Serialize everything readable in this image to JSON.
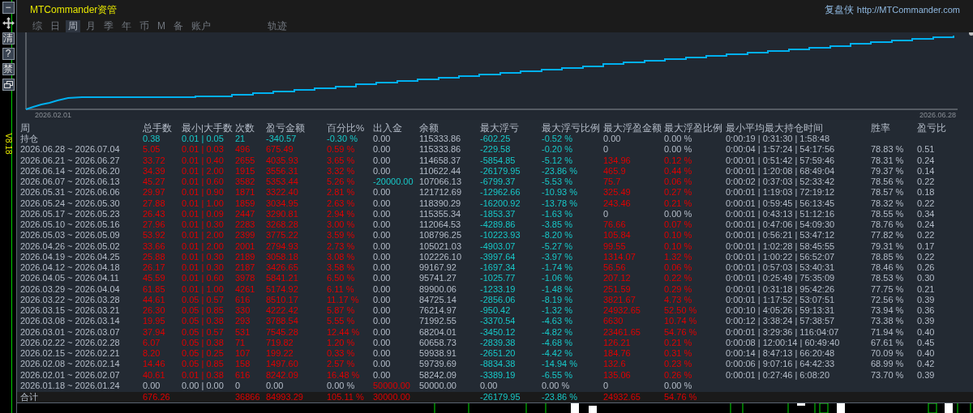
{
  "sidebar": {
    "buttons": [
      {
        "kind": "text",
        "label": "−"
      },
      {
        "kind": "move"
      },
      {
        "kind": "text",
        "label": "清"
      },
      {
        "kind": "text",
        "label": "?"
      },
      {
        "kind": "text",
        "label": "禁"
      },
      {
        "kind": "restore"
      }
    ],
    "version": "V8.18"
  },
  "header": {
    "title": "MTCommander资管",
    "brand": "复盘侠",
    "url": "http://MTCommander.com"
  },
  "tabs": [
    {
      "label": "综",
      "selected": false
    },
    {
      "label": "日",
      "selected": false
    },
    {
      "label": "周",
      "selected": true
    },
    {
      "label": "月",
      "selected": false
    },
    {
      "label": "季",
      "selected": false
    },
    {
      "label": "年",
      "selected": false
    },
    {
      "label": "币",
      "selected": false
    },
    {
      "label": "M",
      "selected": false
    },
    {
      "label": "备",
      "selected": false
    },
    {
      "label": "账户",
      "selected": false
    }
  ],
  "view_tabs": [
    {
      "label": "轨迹",
      "selected": false
    }
  ],
  "chart": {
    "start_label": "2026.02.01",
    "end_label": "2026.06.28"
  },
  "table": {
    "columns": [
      "周",
      "总手数",
      "最小|大手数",
      "次数",
      "盈亏金额",
      "百分比%",
      "出入金",
      "余额",
      "最大浮亏",
      "最大浮亏比例",
      "最大浮盈金额",
      "最大浮盈比例",
      "最小平均最大持仓时间",
      "胜率",
      "盈亏比"
    ],
    "rows": [
      {
        "kind": "holding",
        "label": "持仓",
        "total_lots": "0.38",
        "min_max_lots": "0.01 | 0.05",
        "trades": "21",
        "profit": "-340.57",
        "percent": "-0.30 %",
        "deposit": "0.00",
        "balance": "115333.86",
        "max_float_loss": "-602.25",
        "max_float_loss_pct": "-0.52 %",
        "max_float_profit": "0.00",
        "max_float_profit_pct": "0.00 %",
        "hold_times": "0:00:19 | 0:31:30 | 1:58:48"
      },
      {
        "kind": "week",
        "label": "2026.06.28 ~ 2026.07.04",
        "total_lots": "5.05",
        "min_max_lots": "0.01 | 0.03",
        "trades": "496",
        "profit": "675.49",
        "percent": "0.59 %",
        "deposit": "0.00",
        "balance": "115333.86",
        "max_float_loss": "-229.58",
        "max_float_loss_pct": "-0.20 %",
        "max_float_profit": "0",
        "max_float_profit_pct": "0.00 %",
        "hold_times": "0:00:04 | 1:57:24 | 54:17:56",
        "win_rate": "78.83 %",
        "profit_factor": "0.51"
      },
      {
        "kind": "week",
        "label": "2026.06.21 ~ 2026.06.27",
        "total_lots": "33.72",
        "min_max_lots": "0.01 | 0.40",
        "trades": "2655",
        "profit": "4035.93",
        "percent": "3.65 %",
        "deposit": "0.00",
        "balance": "114658.37",
        "max_float_loss": "-5854.85",
        "max_float_loss_pct": "-5.12 %",
        "max_float_profit": "134.96",
        "max_float_profit_pct": "0.12 %",
        "hold_times": "0:00:01 | 0:51:42 | 57:59:46",
        "win_rate": "78.31 %",
        "profit_factor": "0.24"
      },
      {
        "kind": "week",
        "label": "2026.06.14 ~ 2026.06.20",
        "total_lots": "34.39",
        "min_max_lots": "0.01 | 2.00",
        "trades": "1915",
        "profit": "3556.31",
        "percent": "3.32 %",
        "deposit": "0.00",
        "balance": "110622.44",
        "max_float_loss": "-26179.95",
        "max_float_loss_pct": "-23.86 %",
        "max_float_profit": "465.9",
        "max_float_profit_pct": "0.44 %",
        "hold_times": "0:00:01 | 1:20:08 | 68:49:04",
        "win_rate": "79.37 %",
        "profit_factor": "0.14"
      },
      {
        "kind": "week",
        "label": "2026.06.07 ~ 2026.06.13",
        "total_lots": "45.27",
        "min_max_lots": "0.01 | 0.60",
        "trades": "3582",
        "profit": "5353.44",
        "percent": "5.26 %",
        "deposit": "-20000.00",
        "balance": "107066.13",
        "max_float_loss": "-6799.37",
        "max_float_loss_pct": "-5.53 %",
        "max_float_profit": "75.7",
        "max_float_profit_pct": "0.06 %",
        "hold_times": "0:00:02 | 0:37:03 | 52:33:42",
        "win_rate": "78.56 %",
        "profit_factor": "0.22"
      },
      {
        "kind": "week",
        "label": "2026.05.31 ~ 2026.06.06",
        "total_lots": "29.97",
        "min_max_lots": "0.01 | 0.90",
        "trades": "1871",
        "profit": "3322.40",
        "percent": "2.81 %",
        "deposit": "0.00",
        "balance": "121712.69",
        "max_float_loss": "-12962.66",
        "max_float_loss_pct": "-10.93 %",
        "max_float_profit": "325.49",
        "max_float_profit_pct": "0.27 %",
        "hold_times": "0:00:01 | 1:19:03 | 72:19:12",
        "win_rate": "78.57 %",
        "profit_factor": "0.18"
      },
      {
        "kind": "week",
        "label": "2026.05.24 ~ 2026.05.30",
        "total_lots": "27.88",
        "min_max_lots": "0.01 | 1.00",
        "trades": "1859",
        "profit": "3034.95",
        "percent": "2.63 %",
        "deposit": "0.00",
        "balance": "118390.29",
        "max_float_loss": "-16200.92",
        "max_float_loss_pct": "-13.78 %",
        "max_float_profit": "243.46",
        "max_float_profit_pct": "0.21 %",
        "hold_times": "0:00:01 | 0:59:45 | 56:13:45",
        "win_rate": "78.32 %",
        "profit_factor": "0.22"
      },
      {
        "kind": "week",
        "label": "2026.05.17 ~ 2026.05.23",
        "total_lots": "26.43",
        "min_max_lots": "0.01 | 0.09",
        "trades": "2447",
        "profit": "3290.81",
        "percent": "2.94 %",
        "deposit": "0.00",
        "balance": "115355.34",
        "max_float_loss": "-1853.37",
        "max_float_loss_pct": "-1.63 %",
        "max_float_profit": "0",
        "max_float_profit_pct": "0.00 %",
        "hold_times": "0:00:01 | 0:43:13 | 51:12:16",
        "win_rate": "78.55 %",
        "profit_factor": "0.34"
      },
      {
        "kind": "week",
        "label": "2026.05.10 ~ 2026.05.16",
        "total_lots": "27.96",
        "min_max_lots": "0.01 | 0.30",
        "trades": "2283",
        "profit": "3268.28",
        "percent": "3.00 %",
        "deposit": "0.00",
        "balance": "112064.53",
        "max_float_loss": "-4289.86",
        "max_float_loss_pct": "-3.85 %",
        "max_float_profit": "76.66",
        "max_float_profit_pct": "0.07 %",
        "hold_times": "0:00:01 | 0:47:06 | 54:09:30",
        "win_rate": "78.76 %",
        "profit_factor": "0.24"
      },
      {
        "kind": "week",
        "label": "2026.05.03 ~ 2026.05.09",
        "total_lots": "53.92",
        "min_max_lots": "0.01 | 2.00",
        "trades": "2399",
        "profit": "3775.22",
        "percent": "3.59 %",
        "deposit": "0.00",
        "balance": "108796.25",
        "max_float_loss": "-10223.93",
        "max_float_loss_pct": "-8.20 %",
        "max_float_profit": "105.84",
        "max_float_profit_pct": "0.10 %",
        "hold_times": "0:00:01 | 0:56:21 | 53:47:12",
        "win_rate": "77.82 %",
        "profit_factor": "0.22"
      },
      {
        "kind": "week",
        "label": "2026.04.26 ~ 2026.05.02",
        "total_lots": "33.66",
        "min_max_lots": "0.01 | 2.00",
        "trades": "2001",
        "profit": "2794.93",
        "percent": "2.73 %",
        "deposit": "0.00",
        "balance": "105021.03",
        "max_float_loss": "-4903.07",
        "max_float_loss_pct": "-5.27 %",
        "max_float_profit": "99.55",
        "max_float_profit_pct": "0.10 %",
        "hold_times": "0:00:01 | 1:02:28 | 58:45:55",
        "win_rate": "79.31 %",
        "profit_factor": "0.17"
      },
      {
        "kind": "week",
        "label": "2026.04.19 ~ 2026.04.25",
        "total_lots": "25.88",
        "min_max_lots": "0.01 | 0.30",
        "trades": "2189",
        "profit": "3058.18",
        "percent": "3.08 %",
        "deposit": "0.00",
        "balance": "102226.10",
        "max_float_loss": "-3997.64",
        "max_float_loss_pct": "-3.97 %",
        "max_float_profit": "1314.07",
        "max_float_profit_pct": "1.32 %",
        "hold_times": "0:00:01 | 1:00:22 | 56:52:07",
        "win_rate": "78.85 %",
        "profit_factor": "0.22"
      },
      {
        "kind": "week",
        "label": "2026.04.12 ~ 2026.04.18",
        "total_lots": "26.17",
        "min_max_lots": "0.01 | 0.30",
        "trades": "2187",
        "profit": "3426.65",
        "percent": "3.58 %",
        "deposit": "0.00",
        "balance": "99167.92",
        "max_float_loss": "-1697.34",
        "max_float_loss_pct": "-1.74 %",
        "max_float_profit": "56.56",
        "max_float_profit_pct": "0.06 %",
        "hold_times": "0:00:01 | 0:57:03 | 53:40:31",
        "win_rate": "78.46 %",
        "profit_factor": "0.26"
      },
      {
        "kind": "week",
        "label": "2026.04.05 ~ 2026.04.11",
        "total_lots": "45.59",
        "min_max_lots": "0.01 | 0.60",
        "trades": "3978",
        "profit": "5841.21",
        "percent": "6.50 %",
        "deposit": "0.00",
        "balance": "95741.27",
        "max_float_loss": "-1025.77",
        "max_float_loss_pct": "-1.06 %",
        "max_float_profit": "207.12",
        "max_float_profit_pct": "0.22 %",
        "hold_times": "0:00:01 | 0:25:49 | 75:35:09",
        "win_rate": "78.53 %",
        "profit_factor": "0.30"
      },
      {
        "kind": "week",
        "label": "2026.03.29 ~ 2026.04.04",
        "total_lots": "61.85",
        "min_max_lots": "0.01 | 1.00",
        "trades": "4261",
        "profit": "5174.92",
        "percent": "6.11 %",
        "deposit": "0.00",
        "balance": "89900.06",
        "max_float_loss": "-1233.19",
        "max_float_loss_pct": "-1.48 %",
        "max_float_profit": "251.59",
        "max_float_profit_pct": "0.29 %",
        "hold_times": "0:00:01 | 0:31:18 | 95:42:26",
        "win_rate": "77.75 %",
        "profit_factor": "0.21"
      },
      {
        "kind": "week",
        "label": "2026.03.22 ~ 2026.03.28",
        "total_lots": "44.61",
        "min_max_lots": "0.05 | 0.57",
        "trades": "616",
        "profit": "8510.17",
        "percent": "11.17 %",
        "deposit": "0.00",
        "balance": "84725.14",
        "max_float_loss": "-2856.06",
        "max_float_loss_pct": "-8.19 %",
        "max_float_profit": "3821.67",
        "max_float_profit_pct": "4.73 %",
        "hold_times": "0:00:01 | 1:17:52 | 53:07:51",
        "win_rate": "72.56 %",
        "profit_factor": "0.39"
      },
      {
        "kind": "week",
        "label": "2026.03.15 ~ 2026.03.21",
        "total_lots": "26.30",
        "min_max_lots": "0.05 | 0.85",
        "trades": "330",
        "profit": "4222.42",
        "percent": "5.87 %",
        "deposit": "0.00",
        "balance": "76214.97",
        "max_float_loss": "-950.42",
        "max_float_loss_pct": "-1.32 %",
        "max_float_profit": "24932.65",
        "max_float_profit_pct": "52.50 %",
        "hold_times": "0:00:10 | 4:05:26 | 59:13:31",
        "win_rate": "73.94 %",
        "profit_factor": "0.36"
      },
      {
        "kind": "week",
        "label": "2026.03.08 ~ 2026.03.14",
        "total_lots": "19.95",
        "min_max_lots": "0.05 | 0.38",
        "trades": "293",
        "profit": "3788.54",
        "percent": "5.55 %",
        "deposit": "0.00",
        "balance": "71992.55",
        "max_float_loss": "-3370.54",
        "max_float_loss_pct": "-4.63 %",
        "max_float_profit": "6630",
        "max_float_profit_pct": "10.74 %",
        "hold_times": "0:00:12 | 3:38:24 | 57:38:57",
        "win_rate": "73.38 %",
        "profit_factor": "0.39"
      },
      {
        "kind": "week",
        "label": "2026.03.01 ~ 2026.03.07",
        "total_lots": "37.94",
        "min_max_lots": "0.05 | 0.57",
        "trades": "531",
        "profit": "7545.28",
        "percent": "12.44 %",
        "deposit": "0.00",
        "balance": "68204.01",
        "max_float_loss": "-3450.12",
        "max_float_loss_pct": "-4.82 %",
        "max_float_profit": "23461.65",
        "max_float_profit_pct": "54.76 %",
        "hold_times": "0:00:01 | 3:29:36 | 116:04:07",
        "win_rate": "71.94 %",
        "profit_factor": "0.40"
      },
      {
        "kind": "week",
        "label": "2026.02.22 ~ 2026.02.28",
        "total_lots": "6.07",
        "min_max_lots": "0.05 | 0.38",
        "trades": "71",
        "profit": "719.82",
        "percent": "1.20 %",
        "deposit": "0.00",
        "balance": "60658.73",
        "max_float_loss": "-2839.38",
        "max_float_loss_pct": "-4.68 %",
        "max_float_profit": "126.21",
        "max_float_profit_pct": "0.21 %",
        "hold_times": "0:00:08 | 12:00:14 | 60:49:40",
        "win_rate": "67.61 %",
        "profit_factor": "0.45"
      },
      {
        "kind": "week",
        "label": "2026.02.15 ~ 2026.02.21",
        "total_lots": "8.20",
        "min_max_lots": "0.05 | 0.25",
        "trades": "107",
        "profit": "199.22",
        "percent": "0.33 %",
        "deposit": "0.00",
        "balance": "59938.91",
        "max_float_loss": "-2651.20",
        "max_float_loss_pct": "-4.42 %",
        "max_float_profit": "184.76",
        "max_float_profit_pct": "0.31 %",
        "hold_times": "0:00:14 | 8:47:13 | 66:20:48",
        "win_rate": "70.09 %",
        "profit_factor": "0.40"
      },
      {
        "kind": "week",
        "label": "2026.02.08 ~ 2026.02.14",
        "total_lots": "14.46",
        "min_max_lots": "0.05 | 0.85",
        "trades": "158",
        "profit": "1497.60",
        "percent": "2.57 %",
        "deposit": "0.00",
        "balance": "59739.69",
        "max_float_loss": "-8834.38",
        "max_float_loss_pct": "-14.94 %",
        "max_float_profit": "132.6",
        "max_float_profit_pct": "0.23 %",
        "hold_times": "0:00:06 | 9:07:16 | 64:42:33",
        "win_rate": "68.99 %",
        "profit_factor": "0.42"
      },
      {
        "kind": "week",
        "label": "2026.02.01 ~ 2026.02.07",
        "total_lots": "40.61",
        "min_max_lots": "0.01 | 0.38",
        "trades": "616",
        "profit": "8242.09",
        "percent": "16.48 %",
        "deposit": "0.00",
        "balance": "58242.09",
        "max_float_loss": "-3389.19",
        "max_float_loss_pct": "-6.55 %",
        "max_float_profit": "135.06",
        "max_float_profit_pct": "0.26 %",
        "hold_times": "0:00:01 | 0:27:46 | 6:08:20",
        "win_rate": "73.70 %",
        "profit_factor": "0.39"
      },
      {
        "kind": "week",
        "label": "2026.01.18 ~ 2026.01.24",
        "total_lots": "0.00",
        "min_max_lots": "0.00 | 0.00",
        "trades": "0",
        "profit": "0.00",
        "percent": "0.00 %",
        "deposit": "50000.00",
        "balance": "50000.00",
        "max_float_loss": "0.00",
        "max_float_loss_pct": "0.00 %",
        "max_float_profit": "0",
        "max_float_profit_pct": "0.00 %"
      },
      {
        "kind": "total",
        "label": "合计",
        "total_lots": "676.26",
        "trades": "36866",
        "profit": "84993.29",
        "percent": "105.11 %",
        "deposit": "30000.00",
        "max_float_loss": "-26179.95",
        "max_float_loss_pct": "-23.86 %",
        "max_float_profit": "24932.65",
        "max_float_profit_pct": "54.76 %"
      }
    ]
  }
}
